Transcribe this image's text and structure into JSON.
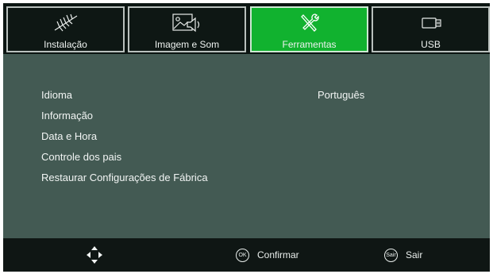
{
  "tabs": [
    {
      "label": "Instalação",
      "icon": "antenna-icon",
      "active": false
    },
    {
      "label": "Imagem e Som",
      "icon": "image-sound-icon",
      "active": false
    },
    {
      "label": "Ferramentas",
      "icon": "tools-icon",
      "active": true
    },
    {
      "label": "USB",
      "icon": "usb-drive-icon",
      "active": false
    }
  ],
  "menu": {
    "items": [
      "Idioma",
      "Informação",
      "Data e Hora",
      "Controle dos pais",
      "Restaurar Configurações de Fábrica"
    ],
    "language_value": "Português"
  },
  "footer": {
    "navigate_icon": "dpad-arrows-icon",
    "ok_key": "OK",
    "confirm_label": "Confirmar",
    "exit_key": "Sair",
    "exit_label": "Sair"
  },
  "colors": {
    "active_tab": "#11b22f",
    "panel": "#435a53",
    "bar": "#0c1512"
  }
}
